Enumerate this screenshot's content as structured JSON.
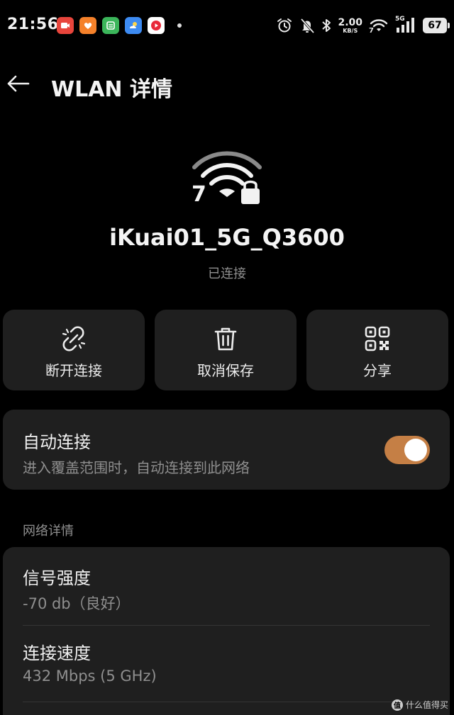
{
  "status_bar": {
    "time": "21:56",
    "net_speed_value": "2.00",
    "net_speed_unit": "KB/S",
    "wifi_badge": "7",
    "cell_tag": "5G",
    "battery": "67",
    "app_icons": [
      {
        "name": "video-app-icon",
        "color": "#e8453c"
      },
      {
        "name": "heart-app-icon",
        "color": "#f5812a"
      },
      {
        "name": "wallet-app-icon",
        "color": "#3bb55a"
      },
      {
        "name": "weather-app-icon",
        "color": "#3d8bf2"
      },
      {
        "name": "play-app-icon",
        "color": "#e8293a"
      }
    ]
  },
  "header": {
    "title": "WLAN 详情"
  },
  "network": {
    "wifi_badge": "7",
    "ssid": "iKuai01_5G_Q3600",
    "status": "已连接"
  },
  "actions": [
    {
      "label": "断开连接",
      "icon": "disconnect-icon"
    },
    {
      "label": "取消保存",
      "icon": "trash-icon"
    },
    {
      "label": "分享",
      "icon": "qr-code-icon"
    }
  ],
  "auto_connect": {
    "title": "自动连接",
    "subtitle": "进入覆盖范围时，自动连接到此网络",
    "enabled": true,
    "accent": "#c57f45"
  },
  "details": {
    "section_label": "网络详情",
    "rows": [
      {
        "label": "信号强度",
        "value": "-70 db（良好）"
      },
      {
        "label": "连接速度",
        "value": "432 Mbps (5 GHz)"
      }
    ]
  },
  "watermark": {
    "logo": "值",
    "text": "什么值得买"
  }
}
